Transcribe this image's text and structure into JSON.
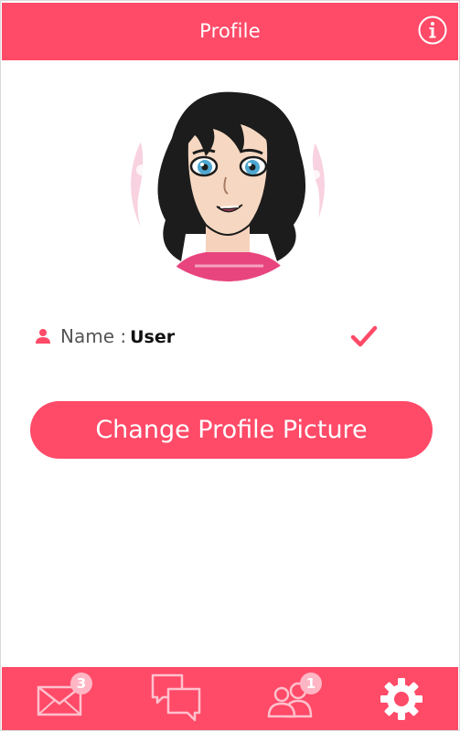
{
  "header": {
    "title": "Profile",
    "info_icon": "info-icon"
  },
  "profile": {
    "avatar_icon": "avatar-cartoon-girl",
    "name_label": "Name :",
    "name_value": "User",
    "user_icon": "user-icon",
    "confirm_icon": "checkmark-icon"
  },
  "actions": {
    "change_picture_label": "Change Profile Picture"
  },
  "bottom_nav": {
    "items": [
      {
        "icon": "envelope-icon",
        "badge": "3"
      },
      {
        "icon": "chat-bubbles-icon",
        "badge": ""
      },
      {
        "icon": "people-icon",
        "badge": "1"
      },
      {
        "icon": "gear-icon",
        "badge": ""
      }
    ]
  },
  "colors": {
    "accent": "#ff4a68",
    "badge": "#ffb6c4",
    "nav_icon_inactive": "#ffc1cd",
    "nav_icon_active": "#ffffff"
  }
}
